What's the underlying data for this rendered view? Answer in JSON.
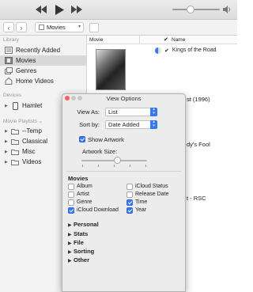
{
  "player": {
    "icons": [
      "rewind-icon",
      "play-icon",
      "fast-forward-icon",
      "speaker-icon"
    ],
    "volume": 0.3
  },
  "nav": {
    "media_select": "Movies"
  },
  "sidebar": {
    "library_header": "Library",
    "library_items": [
      {
        "label": "Recently Added",
        "icon": "recently-added-icon"
      },
      {
        "label": "Movies",
        "icon": "movies-icon",
        "selected": true
      },
      {
        "label": "Genres",
        "icon": "genres-icon"
      },
      {
        "label": "Home Videos",
        "icon": "home-videos-icon"
      }
    ],
    "devices_header": "Devices",
    "device_item": "Hamlet",
    "playlists_header": "Movie Playlists",
    "playlists": [
      "--Temp",
      "Classical",
      "Misc",
      "Videos"
    ]
  },
  "main": {
    "col_movie": "Movie",
    "col_name": "Name",
    "first_row_name": "Kings of the Road",
    "partial_1": "st (1996)",
    "partial_2": "dy's Fool",
    "partial_3": "t - RSC"
  },
  "dialog": {
    "title": "View Options",
    "view_as_label": "View As:",
    "view_as_value": "List",
    "sort_by_label": "Sort by:",
    "sort_by_value": "Date Added",
    "show_artwork_label": "Show Artwork",
    "show_artwork_checked": true,
    "artwork_size_label": "Artwork Size:",
    "artwork_size_level": 0.5,
    "movies_header": "Movies",
    "movie_options_left": [
      {
        "label": "Album",
        "checked": false
      },
      {
        "label": "Artist",
        "checked": false
      },
      {
        "label": "Genre",
        "checked": false
      },
      {
        "label": "iCloud Download",
        "checked": true
      }
    ],
    "movie_options_right": [
      {
        "label": "iCloud Status",
        "checked": false
      },
      {
        "label": "Release Date",
        "checked": false
      },
      {
        "label": "Time",
        "checked": true
      },
      {
        "label": "Year",
        "checked": true
      }
    ],
    "sections": [
      "Personal",
      "Stats",
      "File",
      "Sorting",
      "Other"
    ]
  }
}
